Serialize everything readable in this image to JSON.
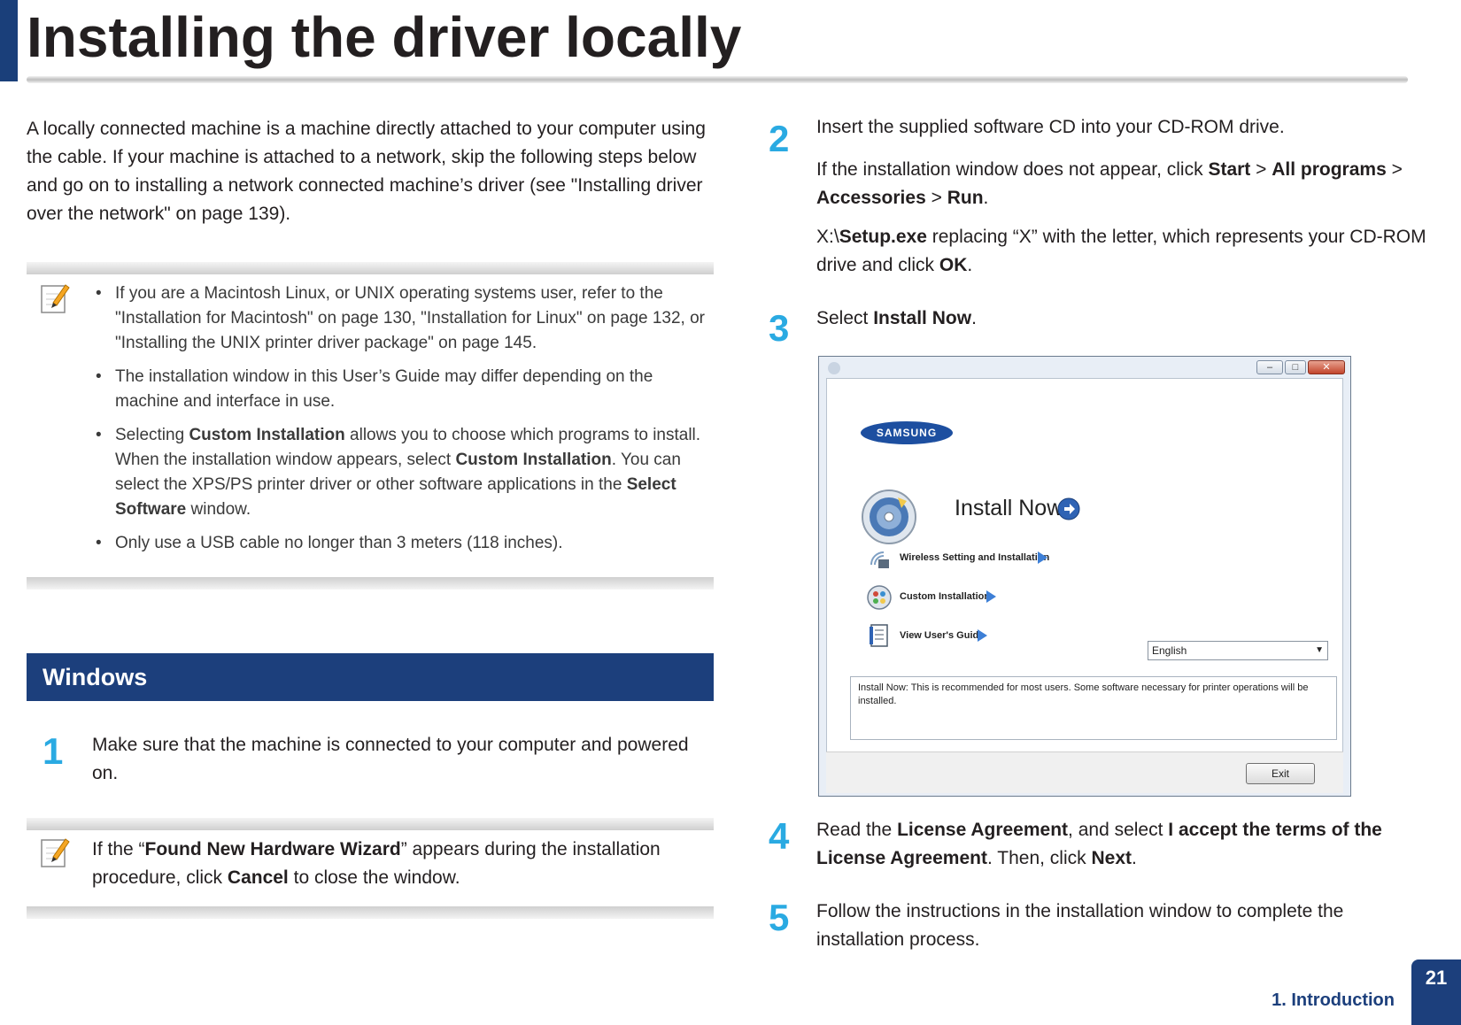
{
  "header": {
    "title": "Installing the driver locally"
  },
  "intro": {
    "text": "A locally connected machine is a machine directly attached to your computer using the cable. If your machine is attached to a network, skip the following steps below and go on to installing a network connected machine’s driver (see \"Installing driver over the network\" on page 139)."
  },
  "note1": {
    "icon": "note-pencil-icon",
    "items": [
      {
        "text": "If you are a Macintosh Linux, or UNIX operating systems user, refer to the \"Installation for Macintosh\" on page 130, \"Installation for Linux\" on page 132, or \"Installing the UNIX printer driver package\" on page 145."
      },
      {
        "text": "The installation window in this User’s Guide may differ depending on the machine and interface in use."
      },
      {
        "pre": "Selecting ",
        "b1": "Custom Installation",
        "mid": " allows you to choose which programs to install. When the installation window appears, select ",
        "b2": "Custom Installation",
        "mid2": ". You can select the XPS/PS printer driver or other software applications in the ",
        "b3": "Select Software",
        "post": " window."
      },
      {
        "text": "Only use a USB cable no longer than 3 meters (118 inches)."
      }
    ]
  },
  "section": {
    "title": "Windows"
  },
  "steps": {
    "s1": {
      "num": "1",
      "text": "Make sure that the machine is connected to your computer and powered on."
    },
    "s2": {
      "num": "2",
      "line1": "Insert the supplied software CD into your CD-ROM drive.",
      "line2_pre": "If the installation window does not appear, click ",
      "start": "Start",
      "sep1": " > ",
      "all_programs": "All programs",
      "sep2": " > ",
      "accessories": "Accessories",
      "sep3": " > ",
      "run": "Run",
      "end1": ".",
      "line3_pre": " X:\\",
      "setup": "Setup.exe",
      "line3_mid": " replacing “X” with the letter, which represents your CD-ROM drive and click ",
      "ok": "OK",
      "end2": "."
    },
    "s3": {
      "num": "3",
      "pre": "Select ",
      "bold": "Install Now",
      "post": "."
    },
    "s4": {
      "num": "4",
      "pre": "Read the ",
      "b1": "License Agreement",
      "mid": ", and select ",
      "b2": "I accept the terms of the License Agreement",
      "mid2": ". Then, click ",
      "b3": "Next",
      "post": "."
    },
    "s5": {
      "num": "5",
      "text": "Follow the instructions in the installation window to complete the installation process."
    }
  },
  "note2": {
    "icon": "note-pencil-icon",
    "pre": "If the “",
    "bold1": "Found New Hardware Wizard",
    "mid": "” appears during the installation procedure, click ",
    "bold2": "Cancel",
    "post": " to close the window."
  },
  "installer": {
    "logo": "SAMSUNG",
    "install_now": "Install Now",
    "options": [
      {
        "label": "Wireless Setting and Installation",
        "icon": "wireless-icon"
      },
      {
        "label": "Custom Installation",
        "icon": "custom-install-icon"
      },
      {
        "label": "View User's Guide",
        "icon": "guide-icon"
      }
    ],
    "language": "English",
    "description": "Install Now: This is recommended for most users. Some software necessary for printer operations will be installed.",
    "exit": "Exit",
    "window_buttons": {
      "minimize": "–",
      "maximize": "□",
      "close": "✕"
    }
  },
  "footer": {
    "section_label": "1. Introduction",
    "page_number": "21"
  },
  "colors": {
    "brand_blue": "#1c3f7c",
    "step_number": "#2aaae2"
  }
}
